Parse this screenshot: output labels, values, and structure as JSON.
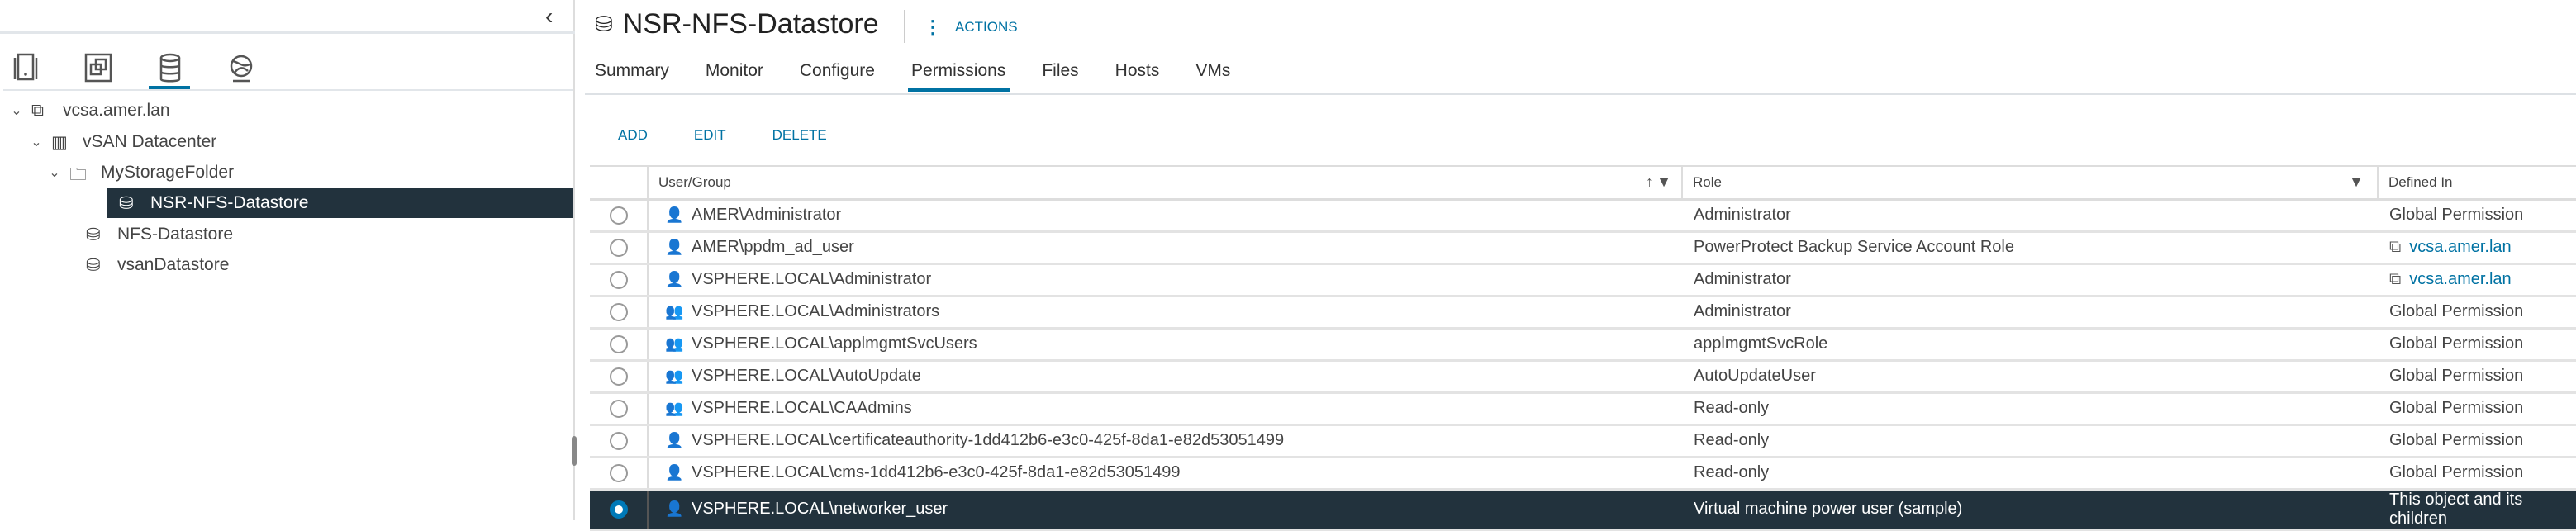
{
  "nav": {
    "collapse_icon": "chevron-left-icon",
    "view_icons": [
      "hosts-and-clusters-icon",
      "vms-and-templates-icon",
      "storage-icon",
      "networking-icon"
    ],
    "active_view": 2
  },
  "tree": [
    {
      "label": "vcsa.amer.lan",
      "icon": "vcenter-icon",
      "level": 0,
      "expanded": true
    },
    {
      "label": "vSAN Datacenter",
      "icon": "datacenter-icon",
      "level": 1,
      "expanded": true
    },
    {
      "label": "MyStorageFolder",
      "icon": "folder-icon",
      "level": 2,
      "expanded": true
    },
    {
      "label": "NSR-NFS-Datastore",
      "icon": "datastore-icon",
      "level": 3,
      "selected": true
    },
    {
      "label": "NFS-Datastore",
      "icon": "datastore-icon",
      "level": 2
    },
    {
      "label": "vsanDatastore",
      "icon": "datastore-icon",
      "level": 2
    }
  ],
  "header": {
    "title": "NSR-NFS-Datastore",
    "actions_label": "ACTIONS"
  },
  "tabs": [
    "Summary",
    "Monitor",
    "Configure",
    "Permissions",
    "Files",
    "Hosts",
    "VMs"
  ],
  "active_tab": "Permissions",
  "toolbar": {
    "add": "ADD",
    "edit": "EDIT",
    "delete": "DELETE"
  },
  "table": {
    "columns": [
      "User/Group",
      "Role",
      "Defined In"
    ],
    "rows": [
      {
        "user": "AMER\\Administrator",
        "type": "user",
        "role": "Administrator",
        "defined_in": "Global Permission",
        "link": false
      },
      {
        "user": "AMER\\ppdm_ad_user",
        "type": "user",
        "role": "PowerProtect Backup Service Account Role",
        "defined_in": "vcsa.amer.lan",
        "link": true
      },
      {
        "user": "VSPHERE.LOCAL\\Administrator",
        "type": "user",
        "role": "Administrator",
        "defined_in": "vcsa.amer.lan",
        "link": true
      },
      {
        "user": "VSPHERE.LOCAL\\Administrators",
        "type": "group",
        "role": "Administrator",
        "defined_in": "Global Permission",
        "link": false
      },
      {
        "user": "VSPHERE.LOCAL\\applmgmtSvcUsers",
        "type": "group",
        "role": "applmgmtSvcRole",
        "defined_in": "Global Permission",
        "link": false
      },
      {
        "user": "VSPHERE.LOCAL\\AutoUpdate",
        "type": "group",
        "role": "AutoUpdateUser",
        "defined_in": "Global Permission",
        "link": false
      },
      {
        "user": "VSPHERE.LOCAL\\CAAdmins",
        "type": "group",
        "role": "Read-only",
        "defined_in": "Global Permission",
        "link": false
      },
      {
        "user": "VSPHERE.LOCAL\\certificateauthority-1dd412b6-e3c0-425f-8da1-e82d53051499",
        "type": "user",
        "role": "Read-only",
        "defined_in": "Global Permission",
        "link": false
      },
      {
        "user": "VSPHERE.LOCAL\\cms-1dd412b6-e3c0-425f-8da1-e82d53051499",
        "type": "user",
        "role": "Read-only",
        "defined_in": "Global Permission",
        "link": false
      },
      {
        "user": "VSPHERE.LOCAL\\networker_user",
        "type": "user",
        "role": "Virtual machine power user (sample)",
        "defined_in": "This object and its children",
        "link": false,
        "selected": true
      }
    ]
  },
  "colors": {
    "accent": "#0072a3",
    "selected_bg": "#22323d"
  }
}
